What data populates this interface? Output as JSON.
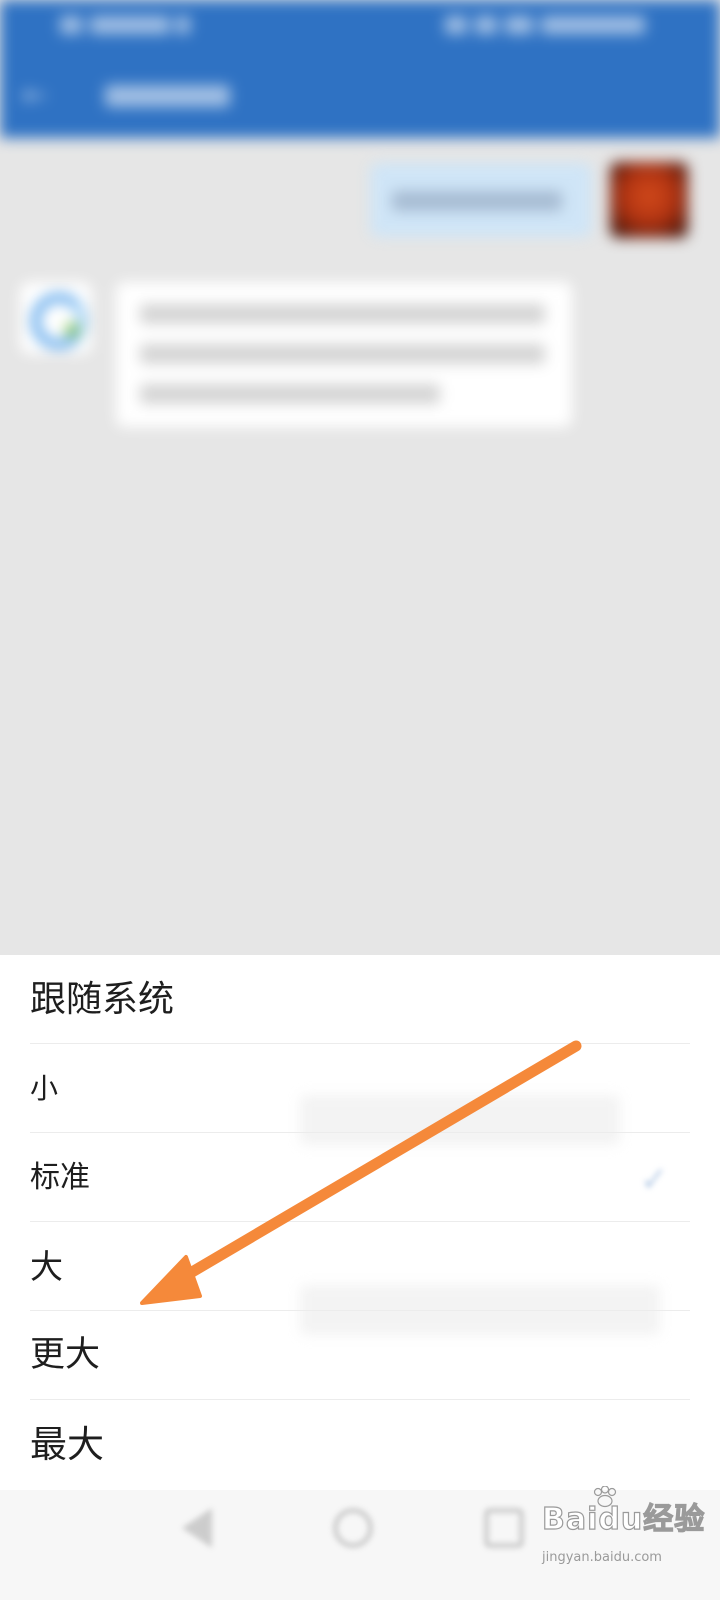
{
  "font_size_sheet": {
    "items": [
      {
        "label": "跟随系统"
      },
      {
        "label": "小"
      },
      {
        "label": "标准"
      },
      {
        "label": "大"
      },
      {
        "label": "更大"
      },
      {
        "label": "最大"
      }
    ],
    "selected_index": 2
  },
  "watermark": {
    "brand": "Baidu经验",
    "sub": "jingyan.baidu.com"
  },
  "colors": {
    "header_blue": "#2f72c3",
    "annotation_arrow": "#f5893a",
    "sheet_background": "#ffffff",
    "dim_background": "#e6e6e6"
  },
  "icons": {
    "back": "arrow-left-icon",
    "selected": "checkmark-icon",
    "nav_back": "triangle-back-icon",
    "nav_home": "circle-home-icon",
    "nav_recent": "square-recent-icon"
  }
}
